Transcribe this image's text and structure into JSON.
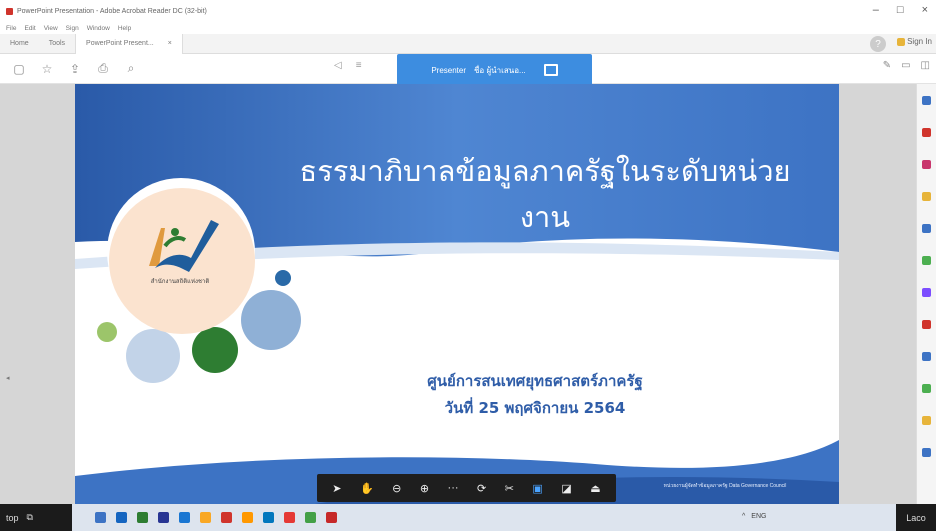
{
  "window": {
    "title": "PowerPoint Presentation - Adobe Acrobat Reader DC (32-bit)",
    "controls": [
      "–",
      "□",
      "×"
    ]
  },
  "menu": [
    "File",
    "Edit",
    "View",
    "Sign",
    "Window",
    "Help"
  ],
  "tabs": {
    "home": "Home",
    "tools": "Tools",
    "document": "PowerPoint Present...",
    "close": "×"
  },
  "account": {
    "help": "?",
    "signin": "Sign In"
  },
  "toolbar": {
    "icons": [
      "page-icon",
      "star-icon",
      "upload-icon",
      "print-icon",
      "search-icon"
    ]
  },
  "pager": {
    "prev": "◁",
    "menu": "≡"
  },
  "presentation_bar": {
    "label": "Presenter",
    "name": "ชื่อ ผู้นำเสนอ..."
  },
  "slide": {
    "title": "ธรรมาภิบาลข้อมูลภาครัฐในระดับหน่วยงาน",
    "subtitle": "ศูนย์การสนเทศยุทธศาสตร์ภาครัฐ",
    "date": "วันที่ 25 พฤศจิกายน 2564",
    "logo_caption": "สำนักงานสถิติแห่งชาติ",
    "footer": "หน่วยงานผู้จัดทำข้อมูลภาครัฐ Data Governance Council",
    "colors": {
      "header": "#3d73c4",
      "header_dark": "#2a5aa8",
      "accent_blue": "#8fb0d6",
      "accent_green": "#2e7d32",
      "accent_light_green": "#9cc56a",
      "logo_bg": "#fbe3cf"
    }
  },
  "slide_controls": [
    "cursor-icon",
    "hand-icon",
    "zoom-out-icon",
    "zoom-in-icon",
    "more-icon",
    "rotate-icon",
    "crop-icon",
    "fit-icon",
    "expand-icon",
    "stamp-icon"
  ],
  "left_panel": {
    "collapse": "◂"
  },
  "right_panel": {
    "icons": [
      "tool-1",
      "tool-2",
      "tool-3",
      "tool-4",
      "tool-5",
      "tool-6",
      "tool-7",
      "tool-8",
      "tool-9",
      "tool-10",
      "tool-11",
      "tool-12"
    ],
    "colors": [
      "#3d73c4",
      "#d0342c",
      "#c9366d",
      "#e7b43a",
      "#3d73c4",
      "#4caf50",
      "#7c4dff",
      "#d0342c",
      "#3d73c4",
      "#4caf50",
      "#e7b43a",
      "#3d73c4"
    ]
  },
  "taskbar": {
    "left_label": "top",
    "icon_colors": [
      "#3d73c4",
      "#1565c0",
      "#2e7d32",
      "#283593",
      "#1976d2",
      "#f9a825",
      "#d0342c",
      "#ff9800",
      "#0277bd",
      "#e53935",
      "#43a047",
      "#c62828"
    ],
    "tray": [
      "^",
      "ENG"
    ],
    "right_label": "Laco"
  }
}
